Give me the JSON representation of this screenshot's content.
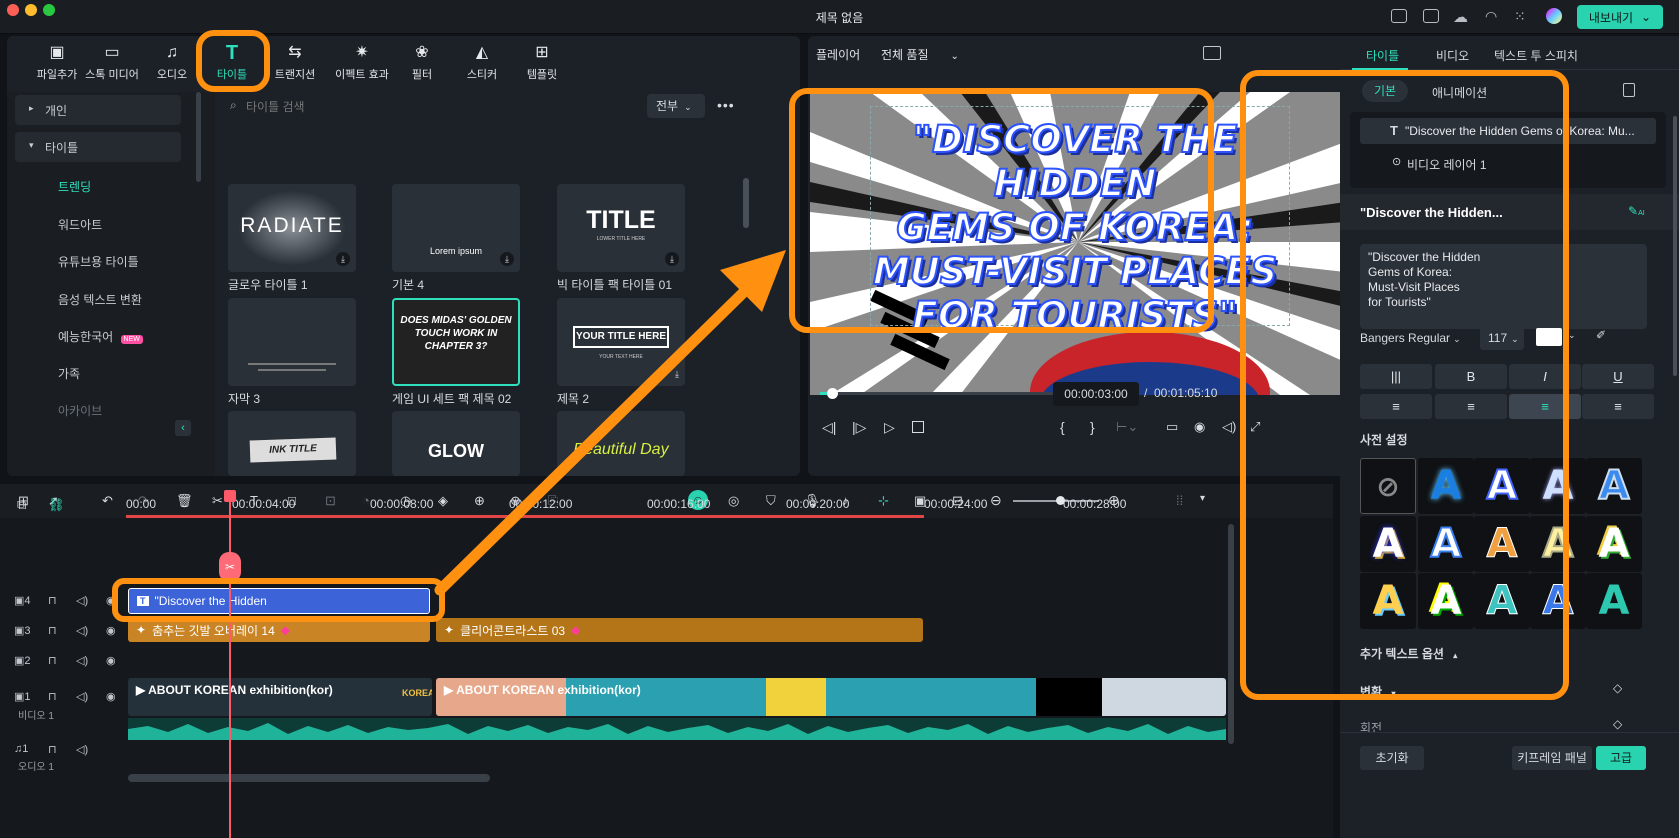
{
  "window": {
    "title": "제목 없음",
    "export_label": "내보내기"
  },
  "toolbar": {
    "items": [
      "파일추가",
      "스톡 미디어",
      "오디오",
      "타이틀",
      "트랜지션",
      "이펙트 효과",
      "필터",
      "스티커",
      "템플릿"
    ]
  },
  "sidebar": {
    "personal": "개인",
    "titles": "타이틀",
    "items": [
      "트렌딩",
      "워드아트",
      "유튜브용 타이틀",
      "음성 텍스트 변환",
      "예능한국어",
      "가족",
      "아카이브"
    ],
    "new_badge": "NEW"
  },
  "search": {
    "placeholder": "타이틀 검색",
    "filter": "전부"
  },
  "cards": [
    {
      "label": "글로우 타이틀 1",
      "thumb": "RADIATE"
    },
    {
      "label": "기본 4",
      "thumb": "Lorem ipsum"
    },
    {
      "label": "빅 타이틀 팩 타이틀 01",
      "thumb": "TITLE",
      "sub": "LOWER TITLE HERE"
    },
    {
      "label": "자막 3",
      "thumb": ""
    },
    {
      "label": "게임 UI 세트 팩 제목 02",
      "thumb": "DOES MIDAS' GOLDEN TOUCH WORK IN CHAPTER 3?"
    },
    {
      "label": "제목 2",
      "thumb": "YOUR TITLE HERE",
      "sub": "YOUR TEXT HERE"
    },
    {
      "label": "",
      "thumb": "INK TITLE"
    },
    {
      "label": "",
      "thumb": "GLOW"
    },
    {
      "label": "",
      "thumb": "Beautiful Day"
    }
  ],
  "player": {
    "label": "플레이어",
    "quality": "전체 품질",
    "overlay_lines": [
      "\"DISCOVER THE HIDDEN",
      "GEMS OF KOREA:",
      "MUST-VISIT PLACES",
      "FOR TOURISTS\""
    ],
    "current_time": "00:00:03:00",
    "separator": "/",
    "total_time": "00:01:05:10",
    "progress": 0.045
  },
  "props": {
    "tabs": [
      "타이틀",
      "비디오",
      "텍스트 투 스피치"
    ],
    "subtabs": [
      "기본",
      "애니메이션"
    ],
    "layer_title": "\"Discover the Hidden Gems of Korea:  Mu...",
    "layer_video": "비디오 레이어 1",
    "section_title": "\"Discover the Hidden...",
    "ai_label": "AI",
    "text_value": "\"Discover the Hidden\nGems of Korea:\nMust-Visit Places\nfor Tourists\"",
    "font": "Bangers Regular",
    "size": "117",
    "bold": "B",
    "italic": "I",
    "underline": "U",
    "preset_label": "사전 설정",
    "extra_options": "추가 텍스트 옵션",
    "transform": "변환",
    "rotate": "회전",
    "reset": "초기화",
    "keyframe": "키프레임 패널",
    "advanced": "고급"
  },
  "timeline": {
    "ruler": [
      "00:00",
      "00:00:04:00",
      "00:00:08:00",
      "00:00:12:00",
      "00:00:16:00",
      "00:00:20:00",
      "00:00:24:00",
      "00:00:28:00"
    ],
    "tracks": [
      "4",
      "3",
      "2",
      "1",
      "1"
    ],
    "video_track_label": "비디오 1",
    "audio_track_label": "오디오 1",
    "clips": {
      "title": "\"Discover the Hidden",
      "effect1": "춤추는 깃발 오버레이 14",
      "effect2": "클리어콘트라스트 03",
      "video1": "ABOUT KOREAN exhibition(kor)",
      "video2": "ABOUT KOREAN exhibition(kor)"
    }
  },
  "colors": {
    "accent": "#29d3b0",
    "highlight": "#ff9010",
    "title_clip": "#3d63d9",
    "effect_clip": "#c98525"
  }
}
